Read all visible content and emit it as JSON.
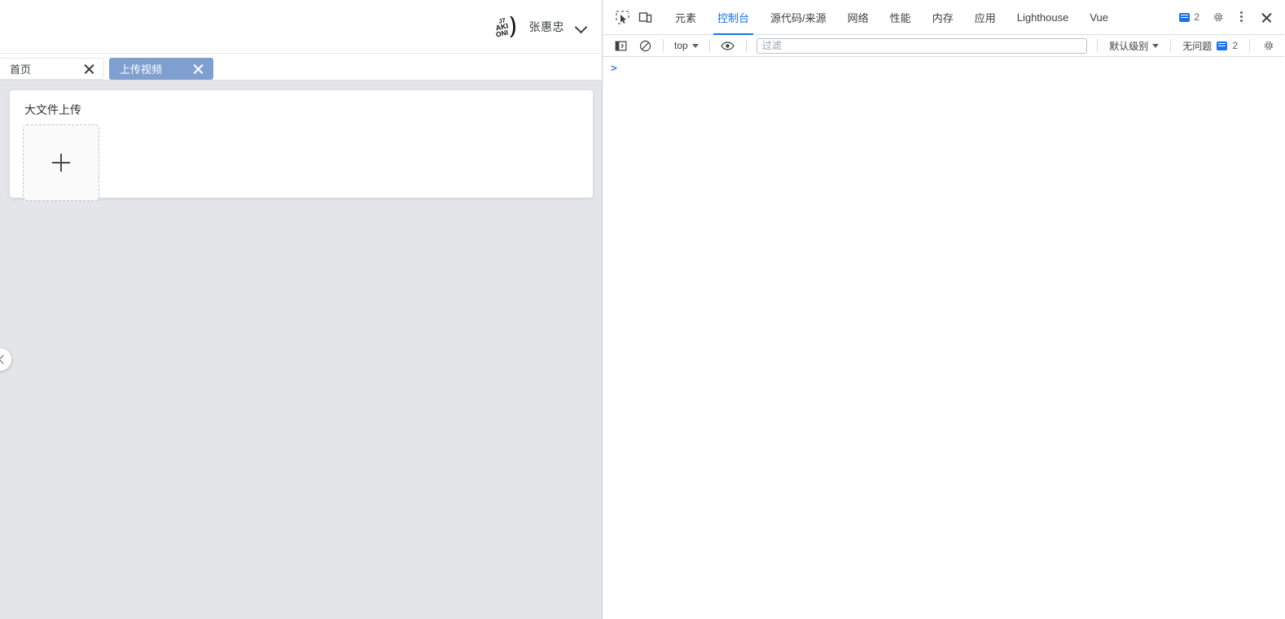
{
  "app": {
    "header": {
      "avatar_icon": "user-avatar-logo",
      "avatar_text_lines": [
        "J7",
        "AKI",
        "ONI"
      ],
      "username": "张惠忠",
      "chevron_icon": "chevron-down-icon"
    },
    "tabs": [
      {
        "label": "首页",
        "active": false,
        "close_icon": "close-icon"
      },
      {
        "label": "上传视频",
        "active": true,
        "close_icon": "close-icon"
      }
    ],
    "card": {
      "title": "大文件上传",
      "upload_plus_icon": "plus-icon"
    },
    "collapse_handle_icon": "chevron-left-icon",
    "colors": {
      "active_tab_bg": "#7f9fd0",
      "page_bg": "#e4e5e9",
      "card_bg": "#ffffff"
    }
  },
  "devtools": {
    "toolbar_icons": {
      "inspect": "inspect-element-icon",
      "device": "device-toolbar-icon"
    },
    "tabs": [
      {
        "label": "元素",
        "selected": false
      },
      {
        "label": "控制台",
        "selected": true
      },
      {
        "label": "源代码/来源",
        "selected": false
      },
      {
        "label": "网络",
        "selected": false
      },
      {
        "label": "性能",
        "selected": false
      },
      {
        "label": "内存",
        "selected": false
      },
      {
        "label": "应用",
        "selected": false
      },
      {
        "label": "Lighthouse",
        "selected": false
      },
      {
        "label": "Vue",
        "selected": false
      }
    ],
    "top_right": {
      "message_icon": "message-badge-icon",
      "message_count": "2",
      "settings_icon": "gear-icon",
      "more_icon": "more-vertical-icon",
      "close_icon": "close-icon"
    },
    "console_bar": {
      "sidebar_icon": "console-sidebar-icon",
      "clear_icon": "clear-console-icon",
      "context": "top",
      "context_chevron_icon": "chevron-down-icon",
      "eye_icon": "live-expression-eye-icon",
      "filter_placeholder": "过滤",
      "filter_value": "",
      "level": "默认级别",
      "level_chevron_icon": "chevron-down-icon",
      "issues_label": "无问题",
      "issues_icon": "message-badge-icon",
      "issues_count": "2",
      "settings_icon": "gear-icon"
    },
    "console_prompt": ">",
    "accent_color": "#1a73e8"
  }
}
